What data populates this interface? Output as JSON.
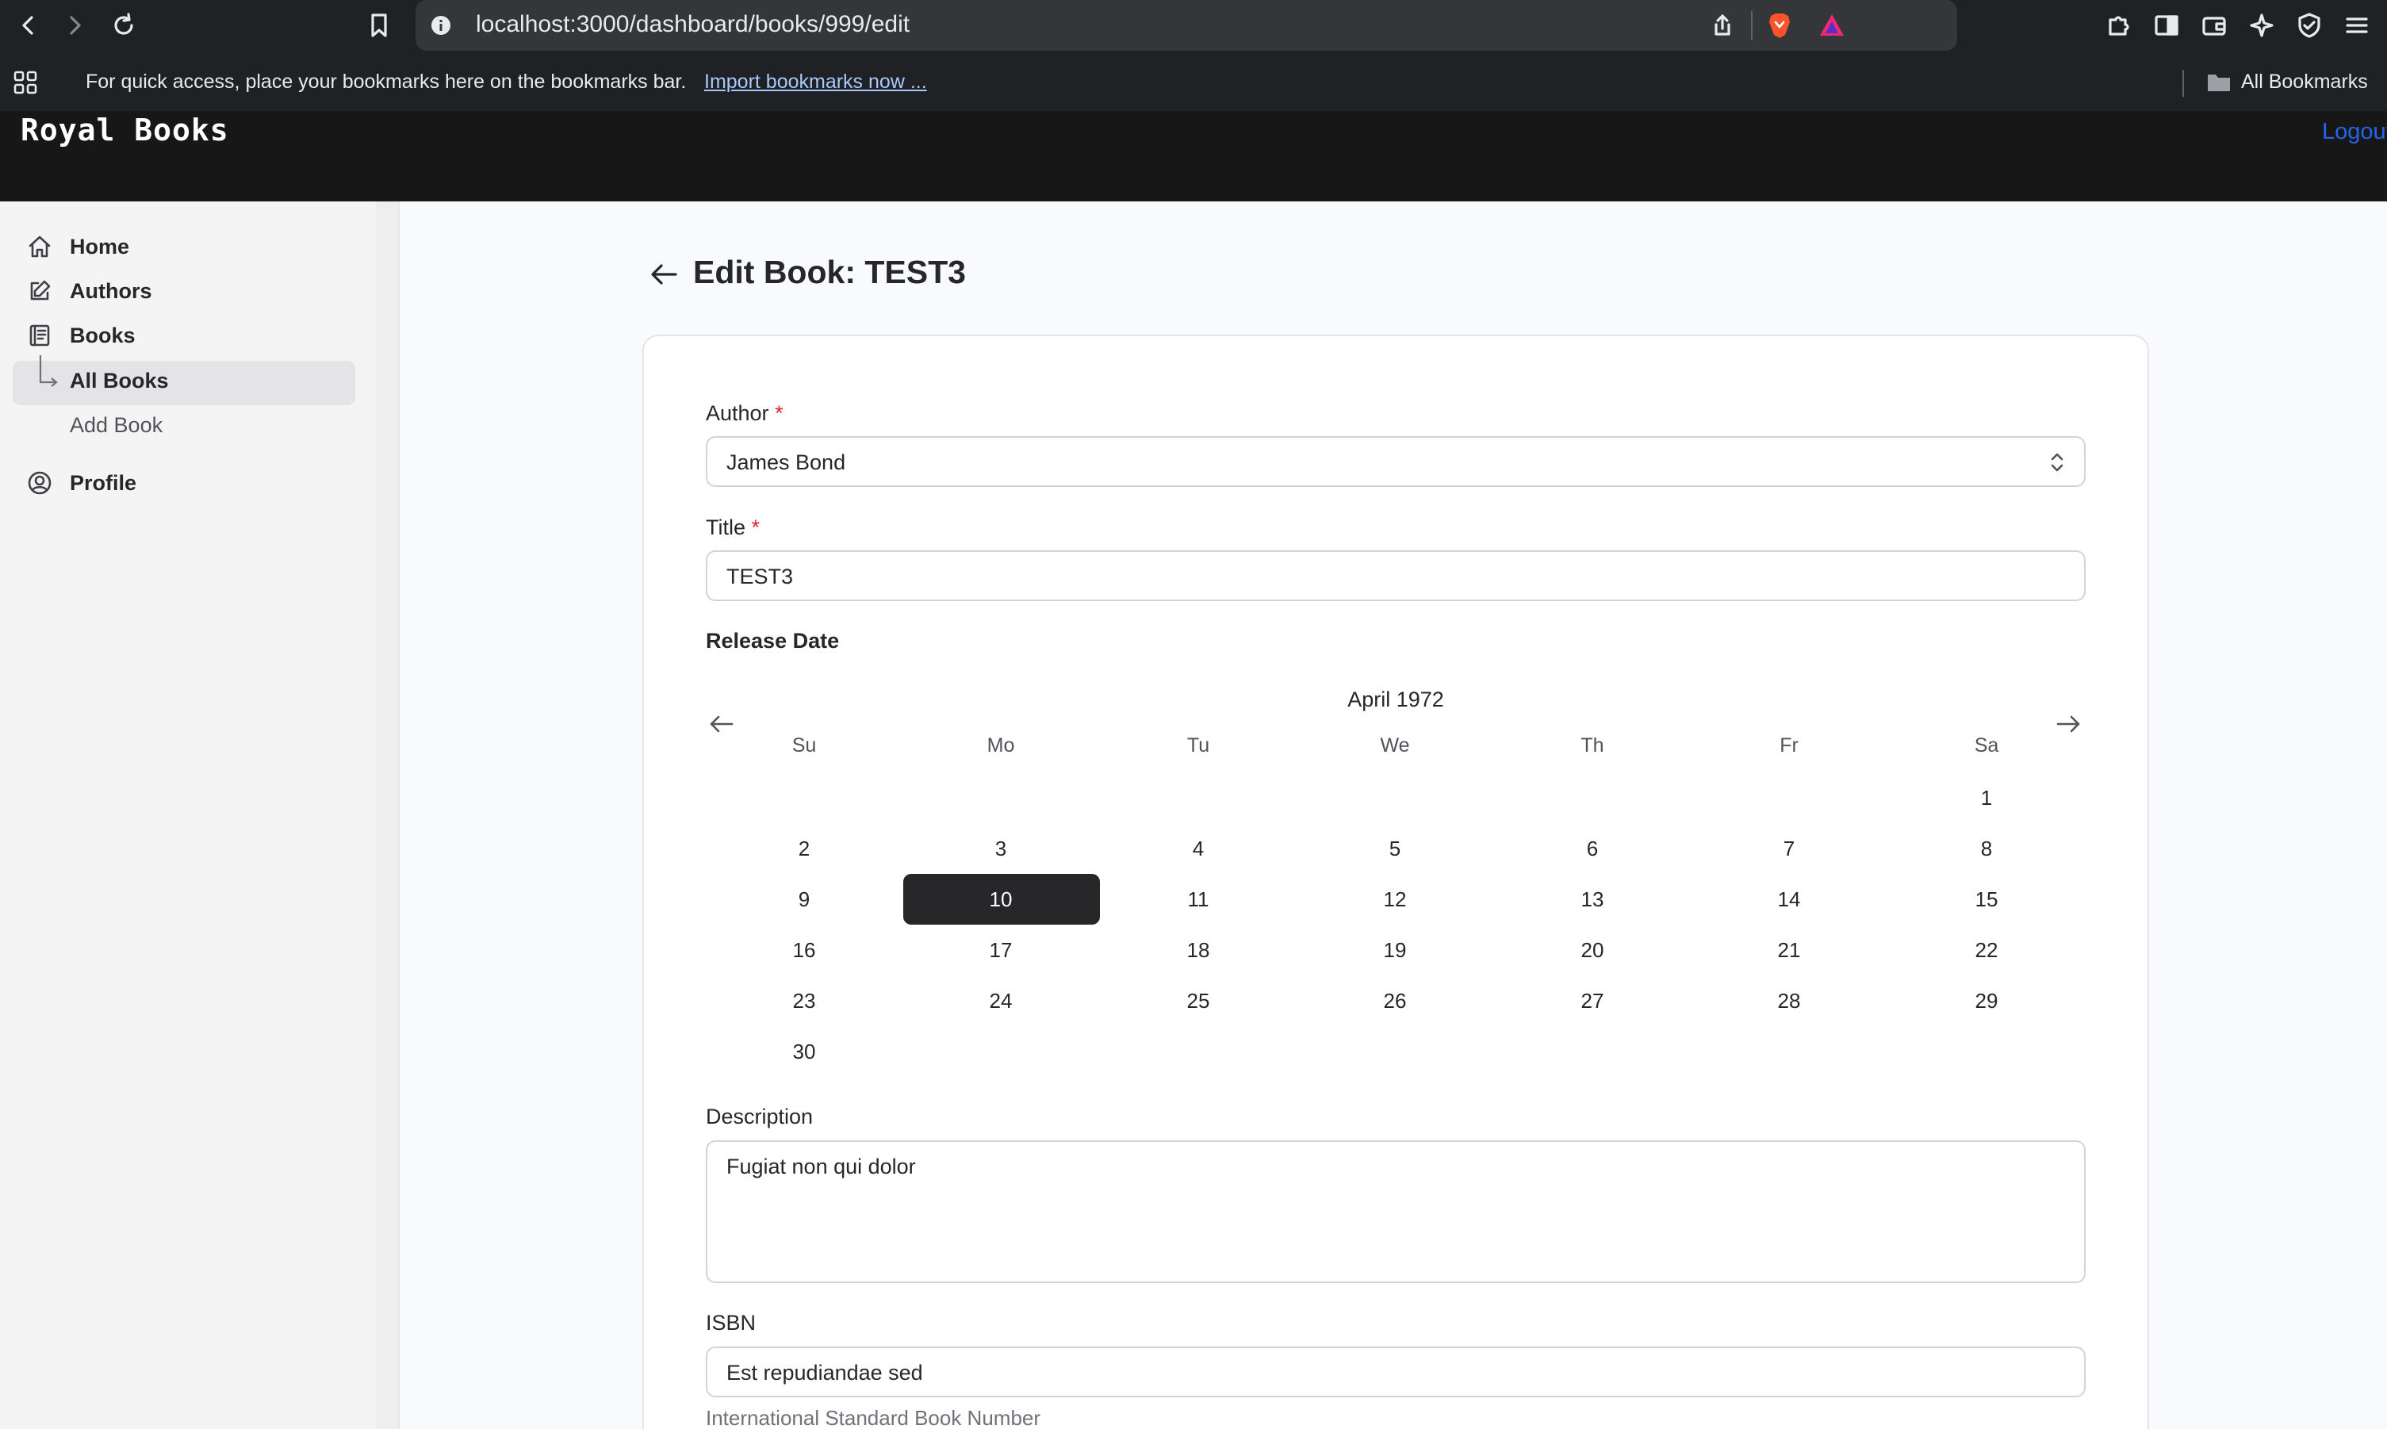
{
  "browser": {
    "url": "localhost:3000/dashboard/books/999/edit",
    "bookmarks_message": "For quick access, place your bookmarks here on the bookmarks bar.",
    "import_link": "Import bookmarks now ...",
    "all_bookmarks": "All Bookmarks"
  },
  "header": {
    "brand": "Royal Books",
    "logout": "Logout"
  },
  "sidebar": {
    "home": "Home",
    "authors": "Authors",
    "books": "Books",
    "all_books": "All Books",
    "add_book": "Add Book",
    "profile": "Profile"
  },
  "page": {
    "title": "Edit Book: TEST3"
  },
  "form": {
    "author_label": "Author",
    "author_value": "James Bond",
    "title_label": "Title",
    "title_value": "TEST3",
    "required_mark": "*",
    "release_label": "Release Date",
    "description_label": "Description",
    "description_value": "Fugiat non qui dolor",
    "isbn_label": "ISBN",
    "isbn_value": "Est repudiandae sed",
    "isbn_helper": "International Standard Book Number"
  },
  "calendar": {
    "month": "April 1972",
    "weekdays": [
      "Su",
      "Mo",
      "Tu",
      "We",
      "Th",
      "Fr",
      "Sa"
    ],
    "first_weekday": 6,
    "days_in_month": 30,
    "selected_day": 10
  },
  "colors": {
    "accent_link": "#2563eb",
    "selected_day_bg": "#27272a",
    "required": "#dc2626"
  },
  "icons": {
    "back": "arrow-left-icon",
    "home": "home-icon",
    "authors": "pencil-square-icon",
    "books": "book-icon",
    "profile": "user-circle-icon",
    "select": "chevron-up-down-icon"
  }
}
